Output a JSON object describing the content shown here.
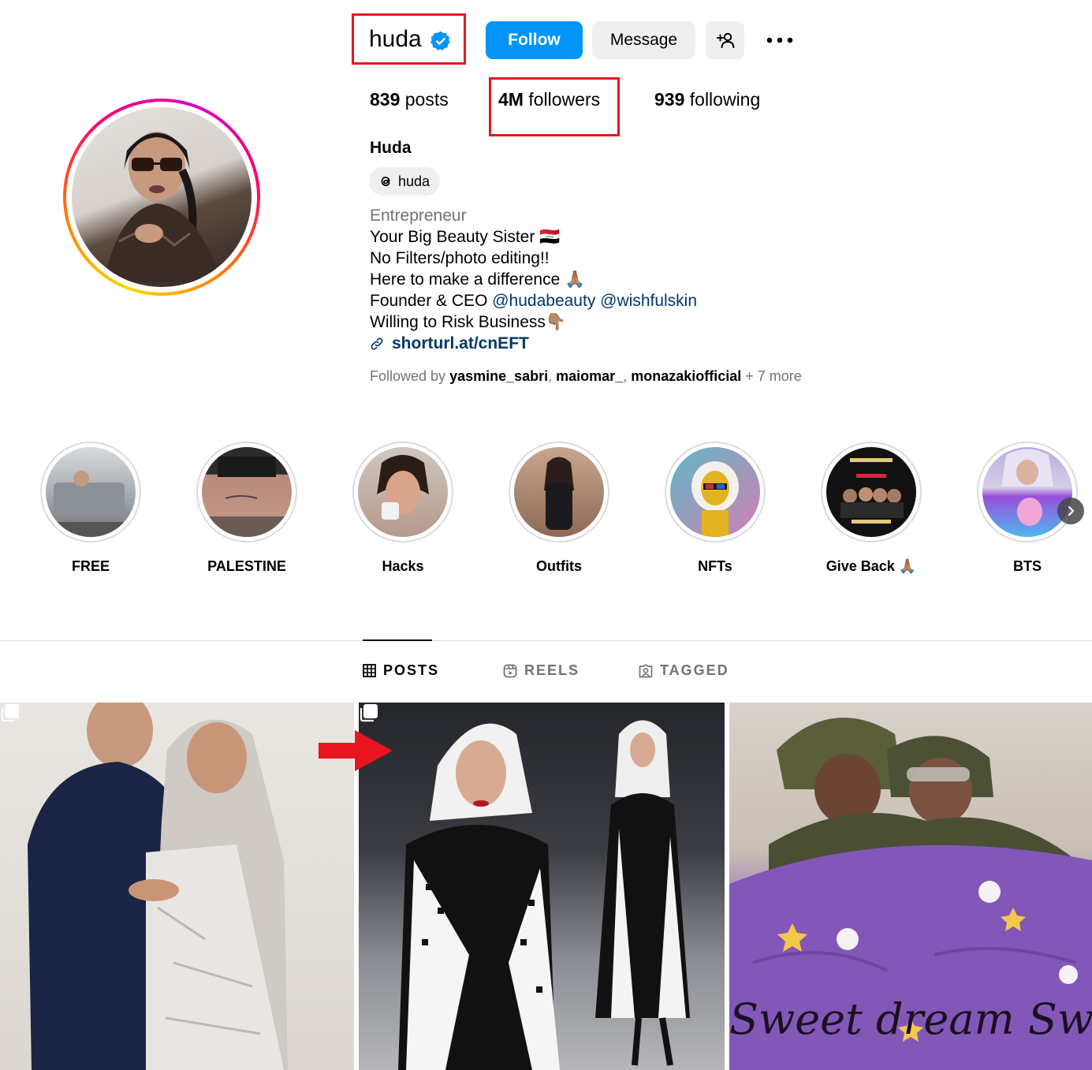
{
  "profile": {
    "username": "huda",
    "verified": true,
    "display_name": "Huda",
    "threads_handle": "huda",
    "stats": {
      "posts_count": "839",
      "posts_label": "posts",
      "followers_count": "4M",
      "followers_label": "followers",
      "following_count": "939",
      "following_label": "following"
    },
    "bio": {
      "category": "Entrepreneur",
      "line1": "Your Big Beauty Sister 🇮🇶",
      "line2": "No Filters/photo editing!!",
      "line3": "Here to make a difference 🙏🏽",
      "line4_prefix": "Founder & CEO ",
      "mention1": "@hudabeauty",
      "mention2": "@wishfulskin",
      "line5": "Willing to Risk Business👇🏽",
      "link": "shorturl.at/cnEFT"
    },
    "followed_by": {
      "prefix": "Followed by ",
      "accounts": [
        "yasmine_sabri",
        "maiomar_",
        "monazakiofficial"
      ],
      "more": "+ 7 more"
    }
  },
  "actions": {
    "follow": "Follow",
    "message": "Message",
    "more": "•••"
  },
  "highlights": [
    {
      "label": "FREE"
    },
    {
      "label": "PALESTINE"
    },
    {
      "label": "Hacks"
    },
    {
      "label": "Outfits"
    },
    {
      "label": "NFTs"
    },
    {
      "label": "Give Back 🙏🏽"
    },
    {
      "label": "BTS"
    }
  ],
  "tabs": {
    "posts": "POSTS",
    "reels": "REELS",
    "tagged": "TAGGED",
    "active": "posts"
  },
  "posts": [
    {
      "multi": true
    },
    {
      "multi": true
    },
    {
      "caption_art": "Sweet dream  Sweet",
      "multi": false
    }
  ],
  "colors": {
    "follow_button": "#0095f6",
    "annotation_red": "#e8141f",
    "link": "#00376b",
    "muted": "#737373"
  }
}
